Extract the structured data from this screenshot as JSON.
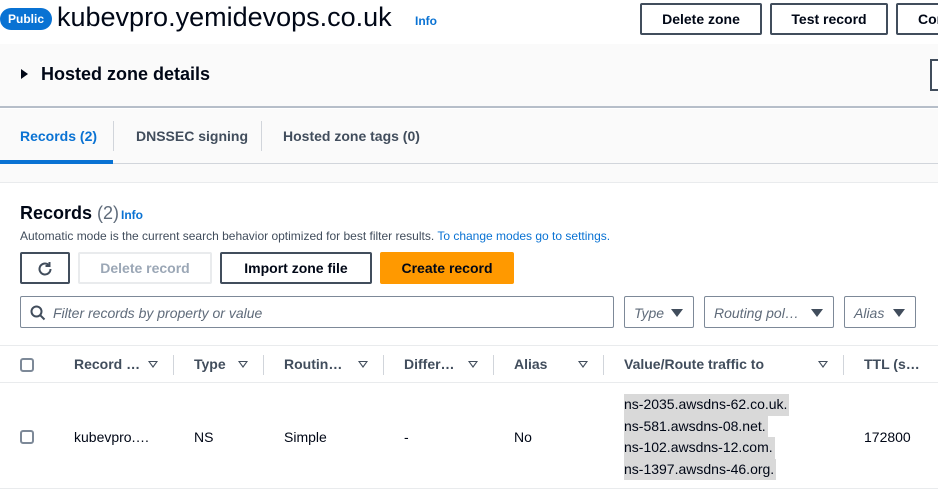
{
  "header": {
    "badge": "Public",
    "zone_name": "kubevpro.yemidevops.co.uk",
    "info": "Info",
    "buttons": {
      "delete_zone": "Delete zone",
      "test_record": "Test record",
      "cont": "Cor"
    }
  },
  "details": {
    "title": "Hosted zone details"
  },
  "tabs": [
    {
      "label": "Records (2)",
      "active": true
    },
    {
      "label": "DNSSEC signing",
      "active": false
    },
    {
      "label": "Hosted zone tags (0)",
      "active": false
    }
  ],
  "records": {
    "title": "Records",
    "count": "(2)",
    "info": "Info",
    "description": "Automatic mode is the current search behavior optimized for best filter results.",
    "description_link": "To change modes go to settings.",
    "buttons": {
      "delete_record": "Delete record",
      "import_zone_file": "Import zone file",
      "create_record": "Create record"
    },
    "filter_placeholder": "Filter records by property or value",
    "selects": {
      "type": "Type",
      "routing": "Routing pol…",
      "alias": "Alias"
    }
  },
  "table": {
    "columns": [
      "Record …",
      "Type",
      "Routin…",
      "Differ…",
      "Alias",
      "Value/Route traffic to",
      "TTL (s…"
    ],
    "rows": [
      {
        "record_name": "kubevpro.…",
        "type": "NS",
        "routing": "Simple",
        "differ": "-",
        "alias": "No",
        "values": [
          "ns-2035.awsdns-62.co.uk.",
          "ns-581.awsdns-08.net.",
          "ns-102.awsdns-12.com.",
          "ns-1397.awsdns-46.org."
        ],
        "ttl": "172800"
      }
    ]
  },
  "colors": {
    "accent": "#0972d3",
    "primary_button": "#ff9900",
    "text": "#000716"
  }
}
